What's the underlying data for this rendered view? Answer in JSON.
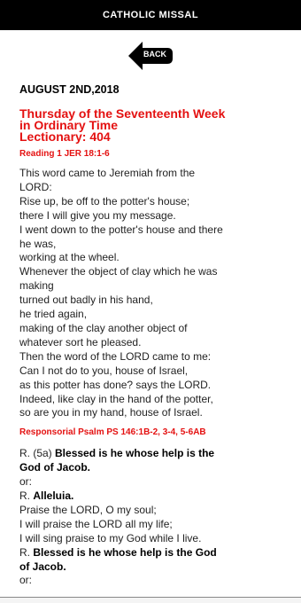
{
  "header": {
    "title": "CATHOLIC MISSAL"
  },
  "back": {
    "label": "BACK"
  },
  "date": "AUGUST 2ND,2018",
  "title_lines": [
    "Thursday of the Seventeenth Week",
    "in Ordinary Time",
    "Lectionary: 404"
  ],
  "reading": {
    "label": "Reading 1  JER 18:1-6",
    "lines": [
      "This word came to Jeremiah from the",
      "LORD:",
      "Rise up, be off to the potter's house;",
      "there I will give you my message.",
      "I went down to the potter's house and there",
      "he was,",
      "working at the wheel.",
      "Whenever the object of clay which he was",
      "making",
      "turned out badly in his hand,",
      "he tried again,",
      "making of the clay another object of",
      "whatever sort he pleased.",
      "Then the word of the LORD came to me:",
      "Can I not do to you, house of Israel,",
      "as this potter has done? says the LORD.",
      "Indeed, like clay in the hand of the potter,",
      "so are you in my hand, house of Israel."
    ]
  },
  "psalm": {
    "label": "Responsorial Psalm  PS 146:1B-2, 3-4, 5-6AB",
    "r1_prefix": "R. (5a) ",
    "r1_bold_1": "Blessed is he whose help is the",
    "r1_bold_2": "God of Jacob.",
    "or1": "or:",
    "r2_prefix": "R. ",
    "r2_bold": "Alleluia.",
    "verse_lines": [
      "Praise the LORD, O my soul;",
      "I will praise the LORD all my life;",
      "I will sing praise to my God while I live."
    ],
    "r3_prefix": "R. ",
    "r3_bold_1": "Blessed is he whose help is the God",
    "r3_bold_2": "of Jacob.",
    "or2": "or:"
  },
  "colors": {
    "header_bg": "#000000",
    "accent_red": "#e41111"
  }
}
